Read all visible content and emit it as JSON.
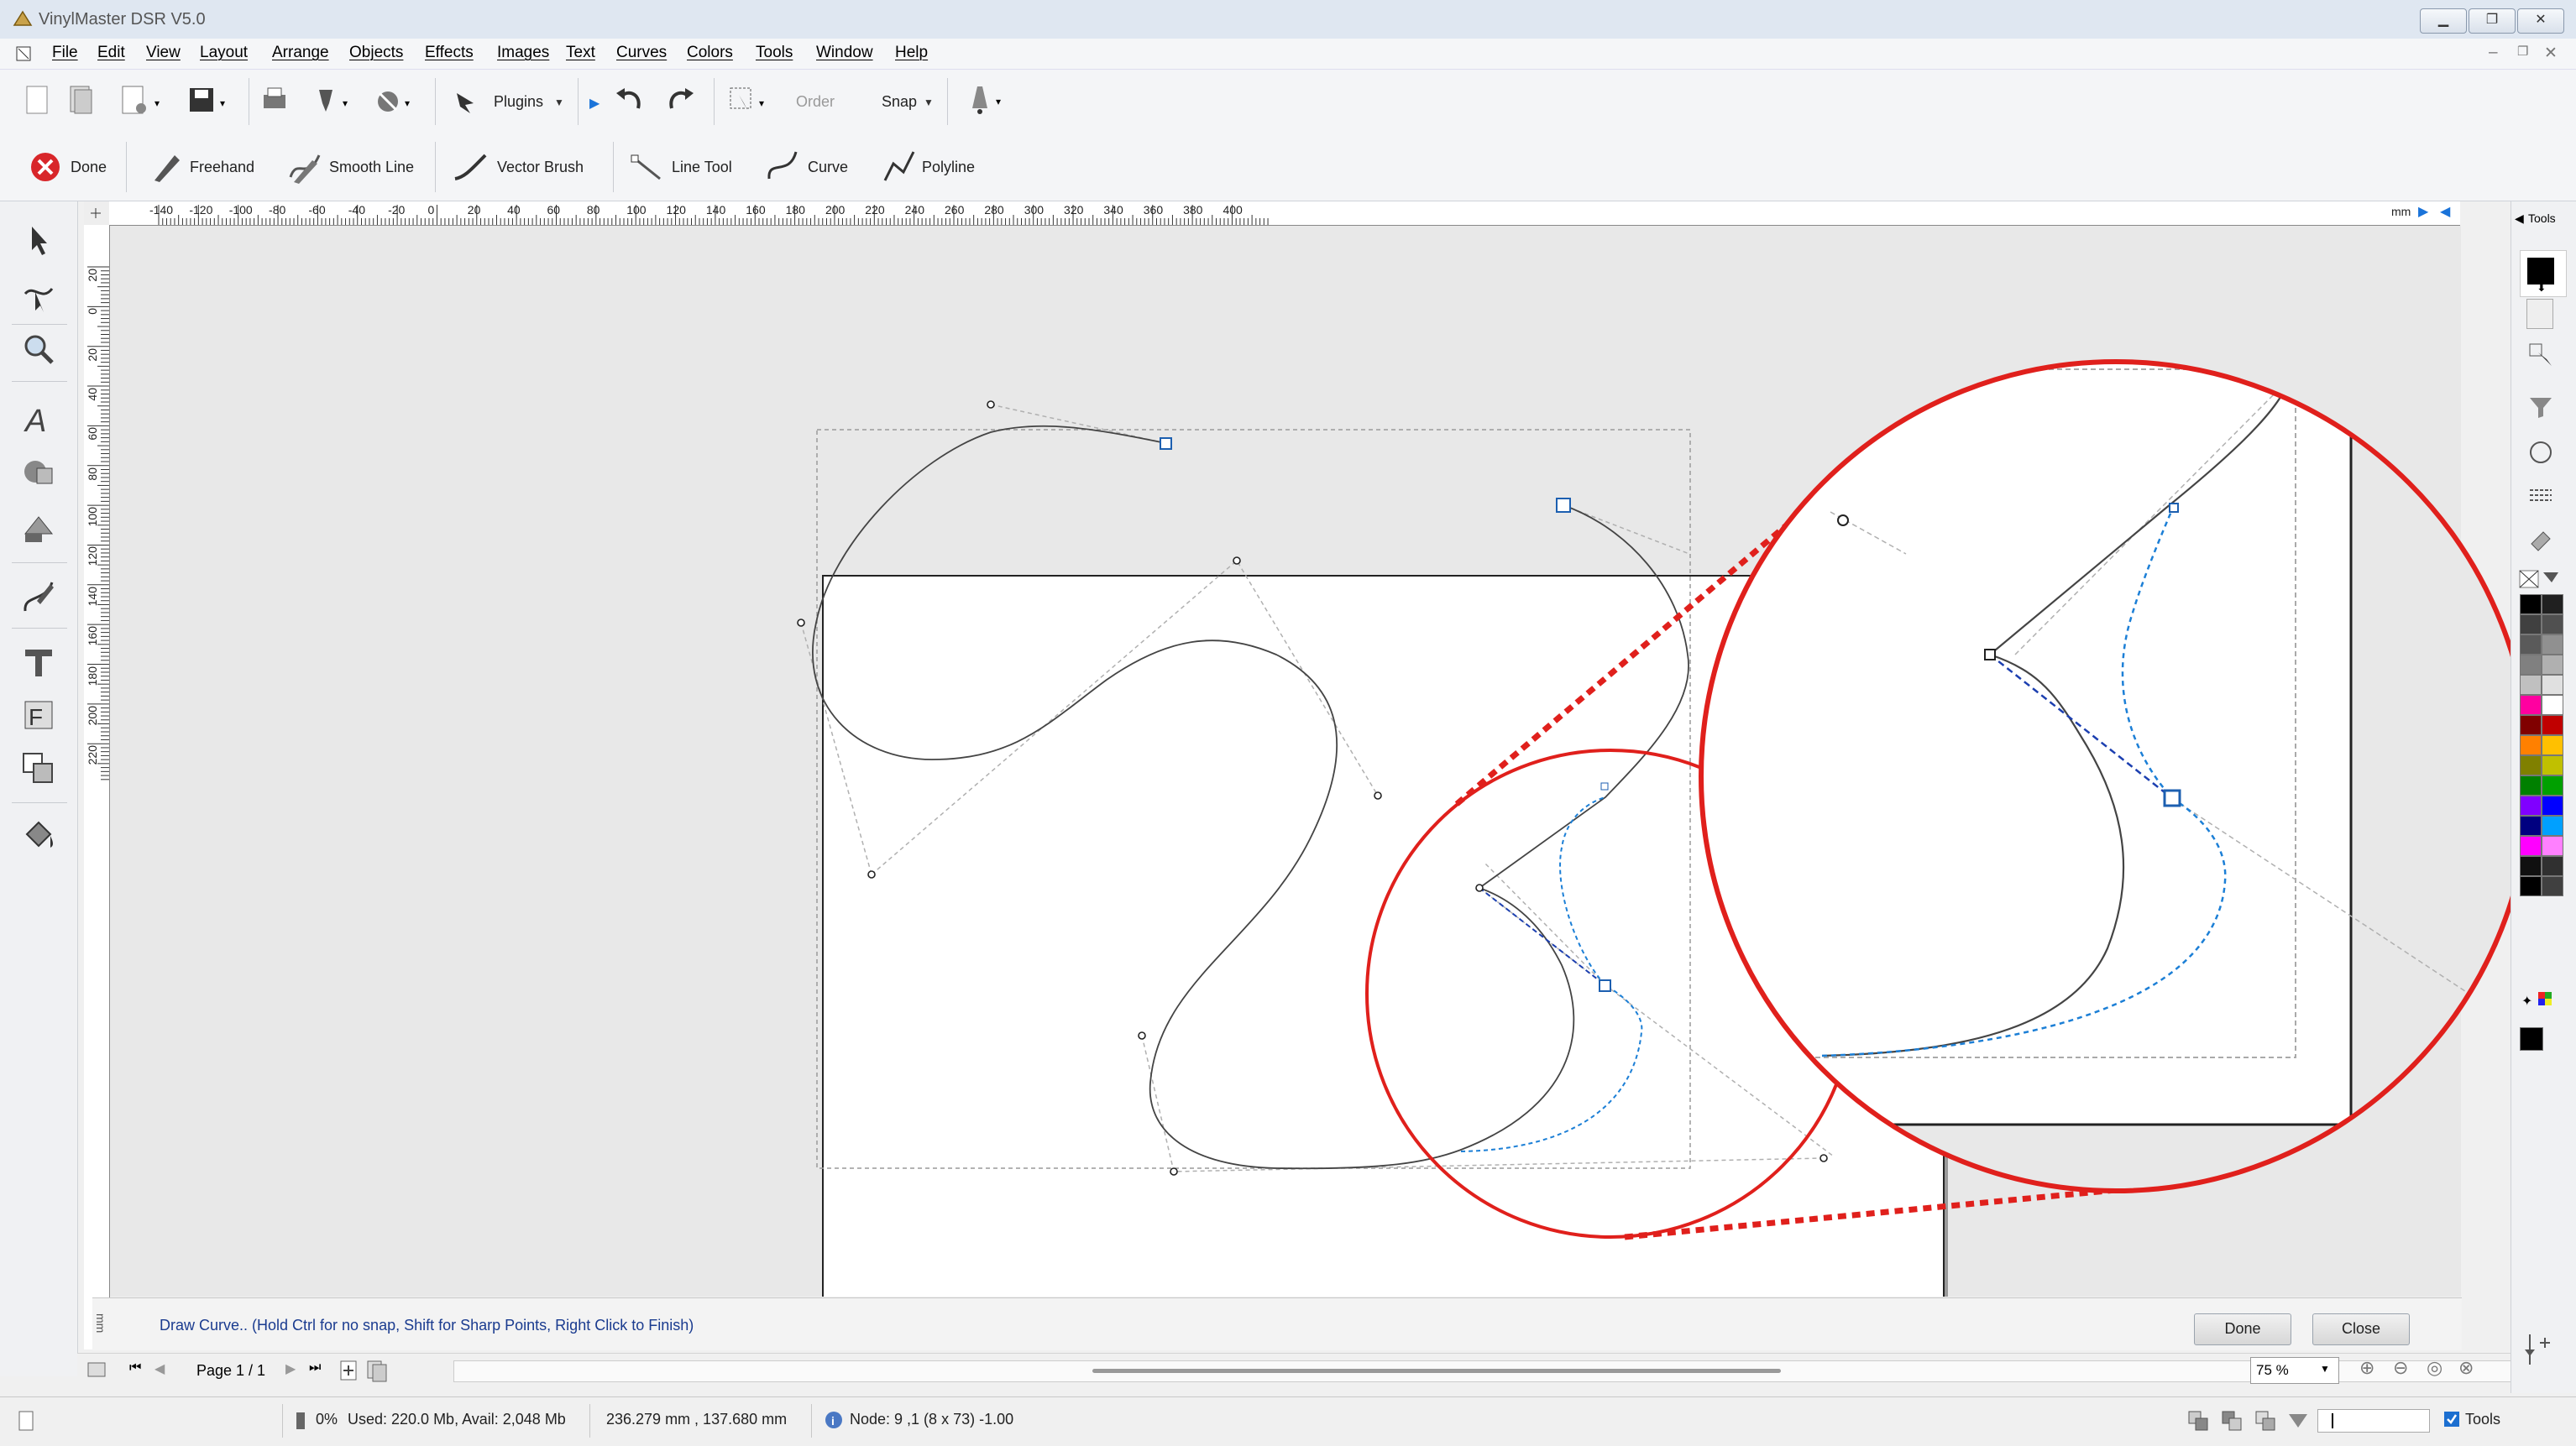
{
  "app": {
    "title": "VinylMaster DSR V5.0"
  },
  "menu": [
    "File",
    "Edit",
    "View",
    "Layout",
    "Arrange",
    "Objects",
    "Effects",
    "Images",
    "Text",
    "Curves",
    "Colors",
    "Tools",
    "Window",
    "Help"
  ],
  "toolbar1": {
    "plugins": "Plugins",
    "order": "Order",
    "snap": "Snap"
  },
  "toolbar2": {
    "done": "Done",
    "freehand": "Freehand",
    "smooth_line": "Smooth Line",
    "vector_brush": "Vector Brush",
    "line_tool": "Line Tool",
    "curve": "Curve",
    "polyline": "Polyline"
  },
  "ruler": {
    "h_ticks": [
      "-140",
      "-120",
      "-100",
      "-80",
      "-60",
      "-40",
      "-20",
      "0",
      "20",
      "40",
      "60",
      "80",
      "100",
      "120",
      "140",
      "160",
      "180",
      "200",
      "220",
      "240",
      "260",
      "280",
      "300",
      "320",
      "340",
      "360",
      "380",
      "400"
    ],
    "v_ticks": [
      "20",
      "0",
      "20",
      "40",
      "60",
      "80",
      "100",
      "120",
      "140",
      "160",
      "180",
      "200",
      "220"
    ],
    "unit": "mm"
  },
  "hint": {
    "text": "Draw Curve..   (Hold Ctrl for no snap,  Shift for Sharp Points,  Right Click to Finish)",
    "done": "Done",
    "close": "Close"
  },
  "nav": {
    "page": "Page 1 / 1",
    "zoom": "75 %"
  },
  "status": {
    "progress": "0%",
    "memory": "Used: 220.0 Mb, Avail: 2,048 Mb",
    "coords": "236.279 mm , 137.680 mm",
    "node": "Node: 9 ,1  (8 x 73) -1.00",
    "tools": "Tools"
  },
  "dock": {
    "tools_tab": "Tools"
  },
  "colors": {
    "accent": "#1c5fb0",
    "highlight": "#e0201c",
    "palette_left": [
      "#000000",
      "#404040",
      "#5a5a5a",
      "#808080",
      "#c0c0c0",
      "#ff00a0",
      "#800000",
      "#ff8000",
      "#808000",
      "#008000",
      "#8000ff",
      "#000080",
      "#ff00ff",
      "#101010",
      "#000000"
    ],
    "palette_right": [
      "#202020",
      "#505050",
      "#909090",
      "#b0b0b0",
      "#e0e0e0",
      "#ffffff",
      "#c00000",
      "#ffc000",
      "#c0c000",
      "#00a000",
      "#0000ff",
      "#00a0ff",
      "#ff80ff",
      "#303030",
      "#404040"
    ]
  }
}
